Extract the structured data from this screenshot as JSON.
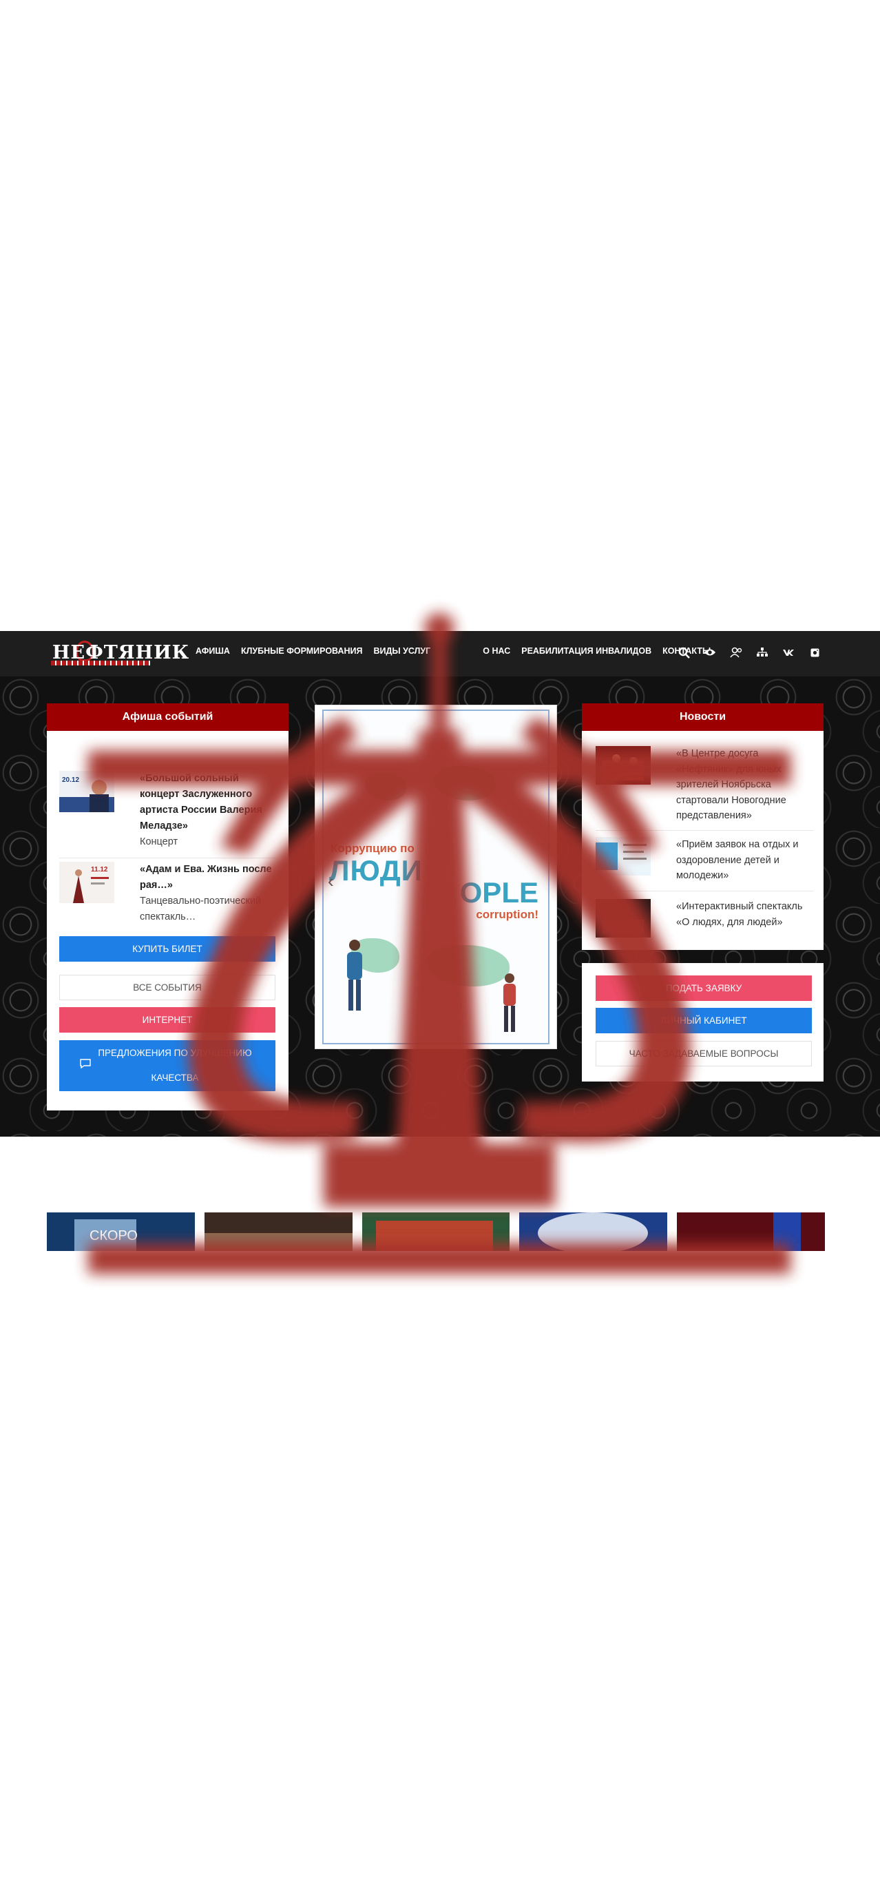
{
  "header": {
    "logo_text": "НЕФТЯНИК",
    "nav": [
      "АФИША",
      "КЛУБНЫЕ ФОРМИРОВАНИЯ",
      "ВИДЫ УСЛУГ",
      "О НАС",
      "РЕАБИЛИТАЦИЯ ИНВАЛИДОВ",
      "КОНТАКТЫ"
    ],
    "icons": [
      "search-icon",
      "eye-icon",
      "user-icon",
      "sitemap-icon",
      "vk-icon",
      "instagram-icon"
    ]
  },
  "events_panel": {
    "title": "Афиша событий",
    "events": [
      {
        "thumb_date": "20.12",
        "title": "«Большой сольный концерт Заслуженного артиста России Валерия Меладзе»",
        "subtitle": "Концерт"
      },
      {
        "thumb_date": "11.12",
        "title": "«Адам и Ева. Жизнь после рая…»",
        "subtitle": "Танцевально-поэтический спектакль…"
      }
    ],
    "buttons": {
      "buy": "КУПИТЬ БИЛЕТ",
      "all_events": "ВСЕ СОБЫТИЯ",
      "internet": "ИНТЕРНЕТ",
      "suggestion": "ПРЕДЛОЖЕНИЯ ПО УЛУЧШЕНИЮ КАЧЕСТВА"
    }
  },
  "slider": {
    "poster_ru_small": "Коррупцию по",
    "poster_ru_big": "ЛЮДИ",
    "poster_en_big": "OPLE",
    "poster_en_sub": "corruption!"
  },
  "news_panel": {
    "title": "Новости",
    "items": [
      "«В Центре досуга «Нефтяник» для юных зрителей Ноябрьска стартовали Новогодние представления»",
      "«Приём заявок на отдых и оздоровление детей и молодежи»",
      "«Интерактивный спектакль «О людях, для людей»"
    ],
    "buttons": {
      "apply": "ПОДАТЬ ЗАЯВКУ",
      "cabinet": "ЛИЧНЫЙ КАБИНЕТ",
      "faq": "ЧАСТО ЗАДАВАЕМЫЕ ВОПРОСЫ"
    }
  },
  "gallery": {
    "first_caption": "СКОРО"
  },
  "colors": {
    "header_bg": "#1e1e1e",
    "panel_head": "#9c0000",
    "blue": "#1e7fe6",
    "pink": "#ee4d69",
    "overlay_red": "#a5312a"
  }
}
